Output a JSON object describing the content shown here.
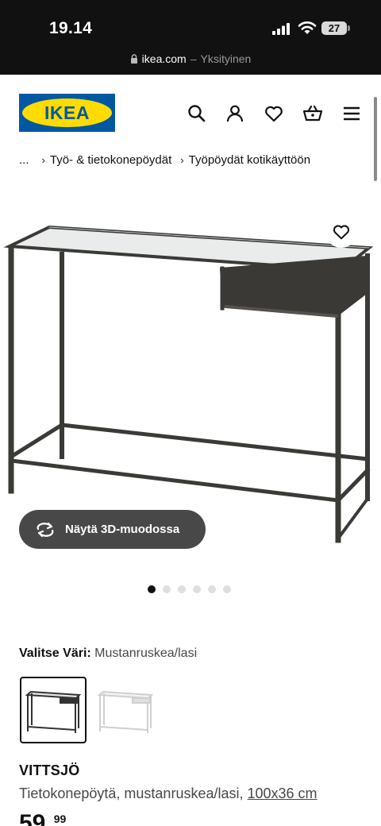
{
  "status_bar": {
    "time": "19.14",
    "battery": "27"
  },
  "url_bar": {
    "domain": "ikea.com",
    "separator": "–",
    "mode": "Yksityinen"
  },
  "header": {
    "logo_text": "IKEA",
    "icons": [
      "search-icon",
      "user-icon",
      "heart-icon",
      "basket-icon",
      "menu-icon"
    ]
  },
  "breadcrumb": {
    "ellipsis": "...",
    "items": [
      "Työ- & tietokonepöydät",
      "Työpöydät kotikäyttöön"
    ]
  },
  "gallery": {
    "view_3d_label": "Näytä 3D-muodossa",
    "image_count": 6,
    "active_index": 0
  },
  "color_selector": {
    "label": "Valitse Väri:",
    "value": "Mustanruskea/lasi",
    "options": [
      "Mustanruskea/lasi",
      "Valkoinen/lasi"
    ],
    "selected_index": 0
  },
  "product": {
    "name": "VITTSJÖ",
    "description": "Tietokonepöytä, mustanruskea/lasi,",
    "size": "100x36 cm",
    "price_main": "59,",
    "price_decimals": "99"
  },
  "colors": {
    "ikea_blue": "#0058a3",
    "ikea_yellow": "#ffdb00",
    "frame": "#3a3a36",
    "button_dark": "#484848"
  }
}
